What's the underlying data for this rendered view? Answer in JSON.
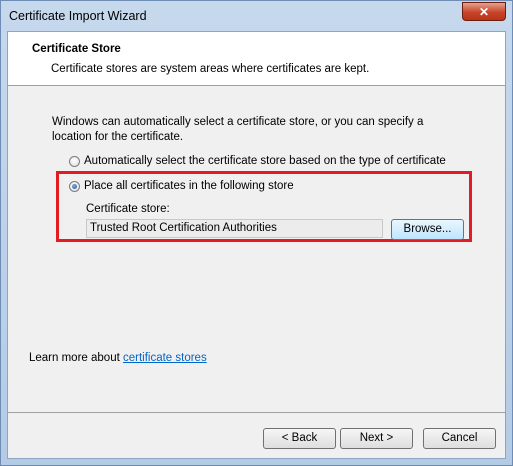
{
  "window": {
    "title": "Certificate Import Wizard",
    "close_glyph": "✕"
  },
  "header": {
    "title": "Certificate Store",
    "description": "Certificate stores are system areas where certificates are kept."
  },
  "main": {
    "intro": "Windows can automatically select a certificate store, or you can specify a location for the certificate.",
    "options": [
      {
        "label": "Automatically select the certificate store based on the type of certificate",
        "selected": false
      },
      {
        "label": "Place all certificates in the following store",
        "selected": true
      }
    ],
    "store_label": "Certificate store:",
    "store_value": "Trusted Root Certification Authorities",
    "browse_label": "Browse...",
    "highlight_color": "#e31b23"
  },
  "learn_more": {
    "prefix": "Learn more about ",
    "link_text": "certificate stores"
  },
  "footer": {
    "back_label": "< Back",
    "next_label": "Next >",
    "cancel_label": "Cancel"
  }
}
